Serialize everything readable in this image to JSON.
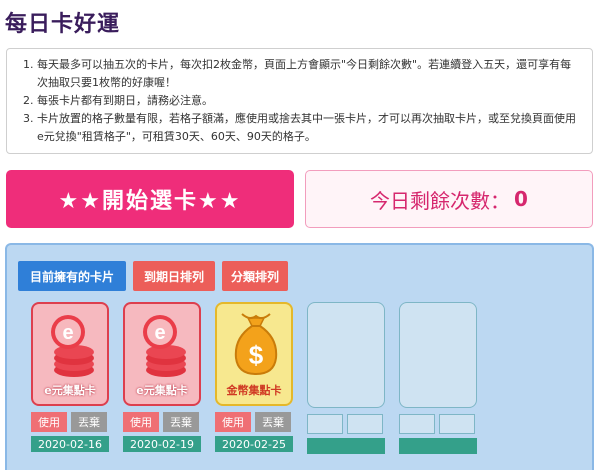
{
  "page": {
    "title": "每日卡好運"
  },
  "rules": [
    "每天最多可以抽五次的卡片，每次扣2枚金幣，頁面上方會顯示\"今日剩餘次數\"。若連續登入五天，還可享有每次抽取只要1枚幣的好康喔！",
    "每張卡片都有到期日，請務必注意。",
    "卡片放置的格子數量有限，若格子額滿，應使用或捨去其中一張卡片，才可以再次抽取卡片，或至兌換頁面使用e元兌換\"租賃格子\"，可租賃30天、60天、90天的格子。"
  ],
  "start_button": {
    "label": "★★開始選卡★★"
  },
  "remaining": {
    "label": "今日剩餘次數：",
    "count": "0"
  },
  "tabs": {
    "owned": "目前擁有的卡片",
    "by_expiry": "到期日排列",
    "by_category": "分類排列"
  },
  "cards": [
    {
      "name": "e元集點卡",
      "icon": "e-coin-stack-icon",
      "use": "使用",
      "discard": "丟棄",
      "expiry": "2020-02-16"
    },
    {
      "name": "e元集點卡",
      "icon": "e-coin-stack-icon",
      "use": "使用",
      "discard": "丟棄",
      "expiry": "2020-02-19"
    },
    {
      "name": "金幣集點卡",
      "icon": "money-bag-icon",
      "use": "使用",
      "discard": "丟棄",
      "expiry": "2020-02-25"
    }
  ],
  "colors": {
    "accent": "#ef2d7a",
    "title": "#3a1d5c",
    "tab_active": "#2f7fd8",
    "tab": "#ec5e59",
    "date_bar": "#34a08a"
  }
}
